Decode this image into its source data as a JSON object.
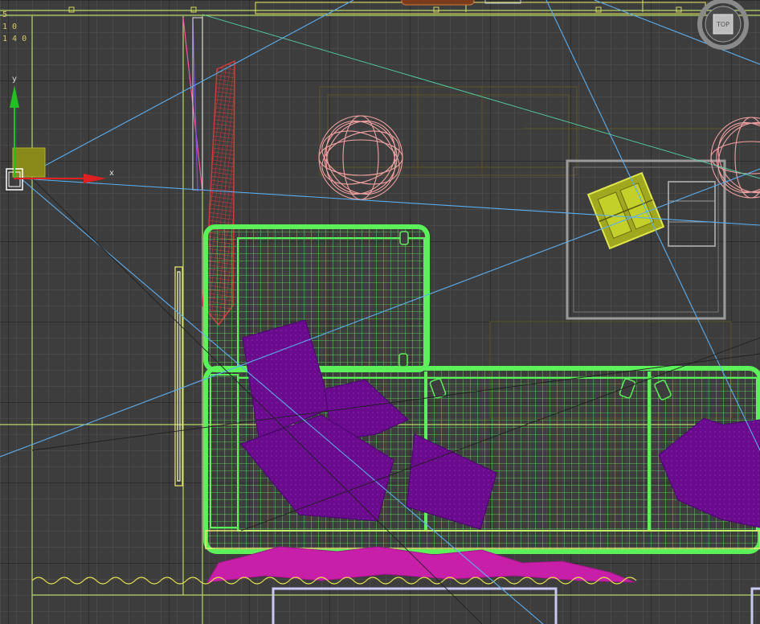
{
  "viewport": {
    "view_name": "Top",
    "viewcube_label": "TOP",
    "axis_x": "x",
    "axis_y": "y",
    "counter_lines": [
      "5",
      "1 0",
      "1 4 0"
    ]
  },
  "colors": {
    "background": "#3d3d3d",
    "grid_minor": "#4f4f4f",
    "grid_major": "#1f1f1f",
    "sofa": "#5cf05a",
    "cushions": "#6a0a8c",
    "rug": "#c81fa8",
    "lamps": "#f0a0a0",
    "curtain": "#d23a3a",
    "window_frame": "#f0f060",
    "selection": "#c3d02a",
    "camera_lines": "#5aaef0",
    "cabinet": "#9a9a9a"
  },
  "objects": [
    {
      "name": "sofa",
      "type": "wireframe-mesh"
    },
    {
      "name": "cushions",
      "type": "mesh"
    },
    {
      "name": "rug",
      "type": "mesh"
    },
    {
      "name": "pendant-lamp-left",
      "type": "wireframe-mesh"
    },
    {
      "name": "pendant-lamp-right",
      "type": "wireframe-mesh"
    },
    {
      "name": "curtain",
      "type": "wireframe-mesh"
    },
    {
      "name": "side-table",
      "type": "wireframe-mesh"
    },
    {
      "name": "selected-object",
      "type": "wireframe-mesh"
    },
    {
      "name": "camera",
      "type": "camera"
    },
    {
      "name": "light-target",
      "type": "helper"
    }
  ]
}
